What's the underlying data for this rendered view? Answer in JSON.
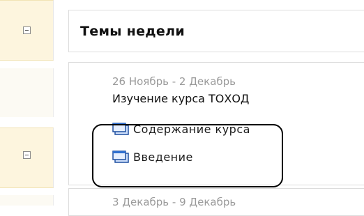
{
  "section_header": {
    "title": "Темы недели"
  },
  "current_week": {
    "date_range": "26 Ноябрь - 2 Декабрь",
    "topic": "Изучение курса ТОХОД",
    "resources": [
      {
        "label": "Содержание курса",
        "icon": "window-icon"
      },
      {
        "label": "Введение",
        "icon": "window-icon"
      }
    ]
  },
  "next_week": {
    "date_range": "3 Декабрь - 9 Декабрь"
  },
  "colors": {
    "sidebar_highlight": "#fdf5de",
    "border": "#dcdcdc",
    "date_text": "#9a9a9a",
    "icon_blue": "#2f6fd0"
  }
}
